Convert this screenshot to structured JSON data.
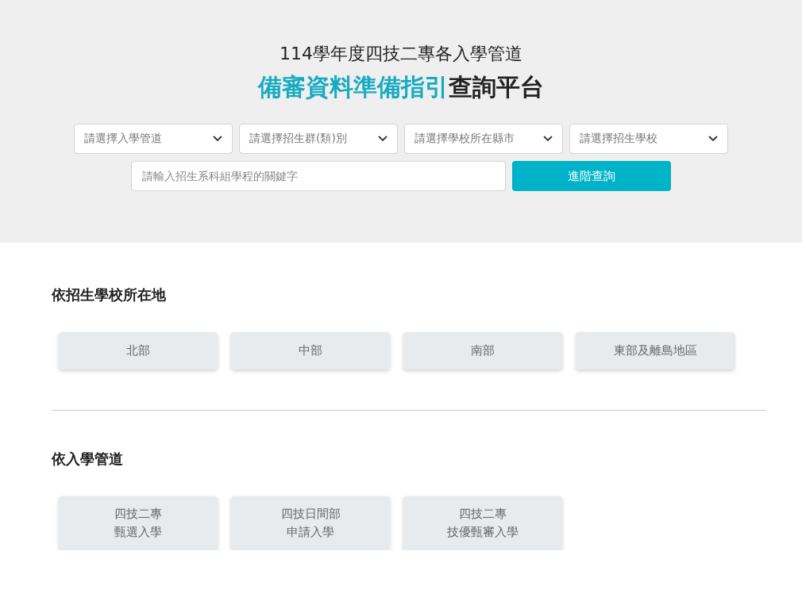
{
  "header": {
    "subtitle": "114學年度四技二專各入學管道",
    "title": {
      "highlight": "備審資料準備指引",
      "rest": "查詢平台"
    }
  },
  "filters": [
    {
      "placeholder": "請選擇入學管道"
    },
    {
      "placeholder": "請選擇招生群(類)別"
    },
    {
      "placeholder": "請選擇學校所在縣市"
    },
    {
      "placeholder": "請選擇招生學校"
    }
  ],
  "search": {
    "placeholder": "請輸入招生系科組學程的關鍵字",
    "button": "進階查詢"
  },
  "sections": [
    {
      "heading": "依招生學校所在地",
      "items": [
        {
          "lines": [
            "北部"
          ]
        },
        {
          "lines": [
            "中部"
          ]
        },
        {
          "lines": [
            "南部"
          ]
        },
        {
          "lines": [
            "東部及離島地區"
          ]
        }
      ]
    },
    {
      "heading": "依入學管道",
      "items": [
        {
          "lines": [
            "四技二專",
            "甄選入學"
          ]
        },
        {
          "lines": [
            "四技日間部",
            "申請入學"
          ]
        },
        {
          "lines": [
            "四技二專",
            "技優甄審入學"
          ]
        }
      ]
    }
  ]
}
